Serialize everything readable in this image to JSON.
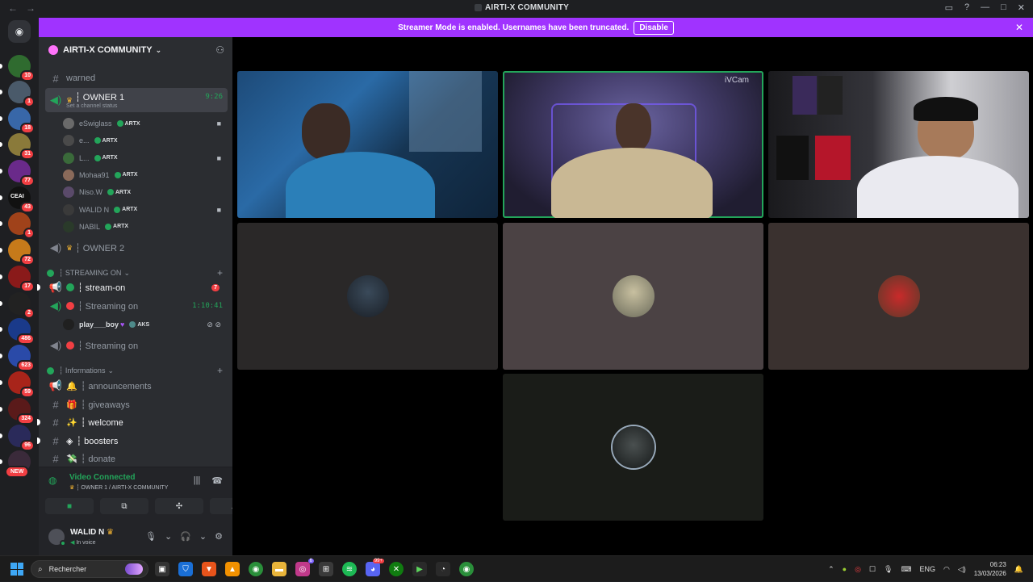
{
  "window": {
    "title": "AIRTI-X COMMUNITY",
    "nav_back": "←",
    "nav_forward": "→"
  },
  "banner": {
    "text": "Streamer Mode is enabled. Usernames have been truncated.",
    "button": "Disable"
  },
  "guilds": [
    {
      "badge": "10",
      "color": "#2f6b2f"
    },
    {
      "badge": "1",
      "color": "#4a5a6a"
    },
    {
      "badge": "18",
      "color": "#3867a8"
    },
    {
      "badge": "31",
      "color": "#8a7a3a"
    },
    {
      "badge": "77",
      "color": "#6a2a8a"
    },
    {
      "badge": "43",
      "color": "#111111",
      "label": "CEAI"
    },
    {
      "badge": "1",
      "color": "#a0421a"
    },
    {
      "badge": "72",
      "color": "#c67a1a"
    },
    {
      "badge": "17",
      "color": "#8a1a1a"
    },
    {
      "badge": "2",
      "color": "#222222"
    },
    {
      "badge": "486",
      "color": "#1a3a8a"
    },
    {
      "badge": "623",
      "color": "#2a4aa8"
    },
    {
      "badge": "59",
      "color": "#a8241a"
    },
    {
      "badge": "324",
      "color": "#5a1a1a"
    },
    {
      "badge": "96",
      "color": "#2a2a5a"
    },
    {
      "badge": "NEW",
      "color": "#3a2a3a"
    }
  ],
  "server": {
    "name": "AIRTI-X COMMUNITY"
  },
  "channels": {
    "warned": "warned",
    "owner1": {
      "name": "┆ OWNER 1",
      "time": "9:26",
      "status": "Set a channel status"
    },
    "members": [
      {
        "name": "eSwiglass",
        "tag": "ARTX",
        "camera": true
      },
      {
        "name": "e...",
        "tag": "ARTX",
        "camera": false
      },
      {
        "name": "L...",
        "tag": "ARTX",
        "camera": true
      },
      {
        "name": "Mohaa91",
        "tag": "ARTX",
        "camera": false
      },
      {
        "name": "Niso.W",
        "tag": "ARTX",
        "camera": false
      },
      {
        "name": "WALID N",
        "tag": "ARTX",
        "camera": true
      },
      {
        "name": "NABIL",
        "tag": "ARTX",
        "camera": false
      }
    ],
    "owner2": "┆ OWNER 2",
    "cat_streaming": "┆ STREAMING ON",
    "stream_on": {
      "name": "┆ stream-on",
      "count": "7"
    },
    "streaming_on_1": {
      "name": "┆ Streaming on",
      "time": "1:10:41"
    },
    "live_user": {
      "name": "play___boy",
      "tag": "AKS"
    },
    "streaming_on_2": "┆ Streaming on",
    "cat_info": "┆ Informations",
    "announcements": "┆ announcements",
    "giveaways": "┆ giveaways",
    "welcome": "┆ welcome",
    "boosters": "┆ boosters",
    "donate": "┆ donate"
  },
  "voice": {
    "status": "Video Connected",
    "location": "┆ OWNER 1 / AIRTI-X COMMUNITY"
  },
  "user": {
    "name": "WALID N",
    "status": "In voice"
  },
  "video": {
    "watermark": "iVCam"
  },
  "taskbar": {
    "search": "Rechercher",
    "lang": "ENG",
    "time": "06:23",
    "date": "13/03/2026",
    "badge1": "6",
    "badge2": "99+"
  },
  "colors": {
    "banner": "#a033ff",
    "green": "#23a55a",
    "red": "#f23f43"
  }
}
